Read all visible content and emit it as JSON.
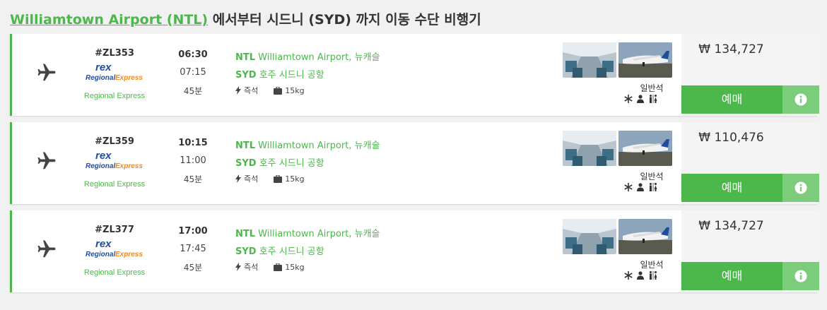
{
  "heading": {
    "link_text": "Williamtown Airport (NTL)",
    "rest_text": " 에서부터 시드니 (SYD) 까지 이동 수단 비행기"
  },
  "flights": [
    {
      "flight_no": "#ZL353",
      "airline": "Regional Express",
      "depart": "06:30",
      "arrive": "07:15",
      "duration": "45분",
      "from_code": "NTL",
      "from_name": "Williamtown Airport, 뉴캐슬",
      "to_code": "SYD",
      "to_name": "호주 시드니 공항",
      "seat_label": "즉석",
      "bag_label": "15kg",
      "seat_class": "일반석",
      "price": "₩ 134,727",
      "book_label": "예매"
    },
    {
      "flight_no": "#ZL359",
      "airline": "Regional Express",
      "depart": "10:15",
      "arrive": "11:00",
      "duration": "45분",
      "from_code": "NTL",
      "from_name": "Williamtown Airport, 뉴캐슬",
      "to_code": "SYD",
      "to_name": "호주 시드니 공항",
      "seat_label": "즉석",
      "bag_label": "15kg",
      "seat_class": "일반석",
      "price": "₩ 110,476",
      "book_label": "예매"
    },
    {
      "flight_no": "#ZL377",
      "airline": "Regional Express",
      "depart": "17:00",
      "arrive": "17:45",
      "duration": "45분",
      "from_code": "NTL",
      "from_name": "Williamtown Airport, 뉴캐슬",
      "to_code": "SYD",
      "to_name": "호주 시드니 공항",
      "seat_label": "즉석",
      "bag_label": "15kg",
      "seat_class": "일반석",
      "price": "₩ 134,727",
      "book_label": "예매"
    }
  ],
  "logo_text": {
    "mark": "rex",
    "wordmark_1": "Regional",
    "wordmark_2": "Express"
  },
  "icons": {
    "mode": "airplane-icon",
    "seat": "lightning-icon",
    "bag": "luggage-icon",
    "cabin": [
      "snowflake-icon",
      "person-icon",
      "restroom-icon"
    ],
    "info": "info-icon"
  },
  "colors": {
    "accent": "#4cb84c",
    "info_button": "#7bcc7b",
    "logo_blue": "#1f4e9c",
    "logo_orange": "#f08a24"
  }
}
